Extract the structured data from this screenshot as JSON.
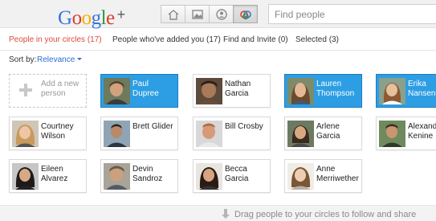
{
  "header": {
    "logo": {
      "letters": [
        "G",
        "o",
        "o",
        "g",
        "l",
        "e"
      ],
      "colors": [
        "#3a73e0",
        "#dd3b2b",
        "#f0b000",
        "#3a73e0",
        "#2c9a3f",
        "#dd3b2b"
      ],
      "plus": "+"
    },
    "nav_icons": [
      "home-icon",
      "photos-icon",
      "profile-icon",
      "circles-icon"
    ],
    "active_nav": "circles-icon",
    "search_placeholder": "Find people"
  },
  "tabs": [
    {
      "label": "People in your circles (17)",
      "active": true
    },
    {
      "label": "People who've added you (17)",
      "active": false
    },
    {
      "label": "Find and Invite (0)",
      "active": false
    },
    {
      "label": "Selected (3)",
      "active": false
    }
  ],
  "sort": {
    "label": "Sort by:",
    "value": "Relevance"
  },
  "add_card": {
    "label": "Add a new\nperson"
  },
  "people": [
    {
      "name": "Paul\nDupree",
      "selected": true
    },
    {
      "name": "Nathan\nGarcia",
      "selected": false
    },
    {
      "name": "Lauren\nThompson",
      "selected": true
    },
    {
      "name": "Erika\nNansen",
      "selected": true
    },
    {
      "name": "Courtney\nWilson",
      "selected": false
    },
    {
      "name": "Brett Glider",
      "selected": false
    },
    {
      "name": "Bill Crosby",
      "selected": false
    },
    {
      "name": "Arlene\nGarcia",
      "selected": false
    },
    {
      "name": "Alexandr\nKenine",
      "selected": false
    },
    {
      "name": "Eileen\nAlvarez",
      "selected": false
    },
    {
      "name": "Devin\nSandroz",
      "selected": false
    },
    {
      "name": "Becca\nGarcia",
      "selected": false
    },
    {
      "name": "Anne\nMerriwether",
      "selected": false
    }
  ],
  "footer": {
    "text": "Drag people to your circles to follow and share"
  },
  "colors": {
    "accent_red": "#dd4b39",
    "selected_blue": "#2d9ee3",
    "link_blue": "#2a6fd6"
  }
}
